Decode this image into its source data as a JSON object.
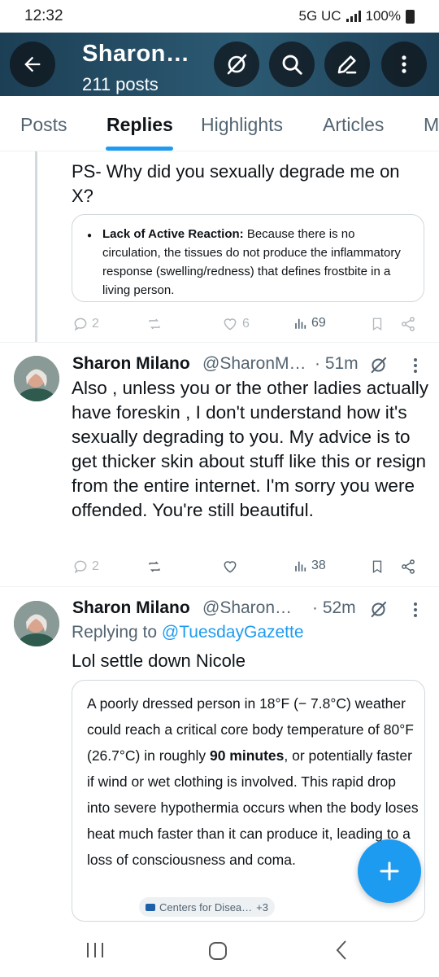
{
  "status_bar": {
    "time": "12:32",
    "network": "5G UC",
    "battery": "100%"
  },
  "header": {
    "title": "Sharon…",
    "subtitle": "211 posts"
  },
  "tabs": [
    {
      "label": "Posts"
    },
    {
      "label": "Replies",
      "active": true
    },
    {
      "label": "Highlights"
    },
    {
      "label": "Articles"
    },
    {
      "label": "M"
    }
  ],
  "posts": [
    {
      "text": "PS- Why did you sexually degrade me on X?",
      "card": {
        "bold": "Lack of Active Reaction:",
        "text": " Because there is no circulation, the tissues do not produce the inflammatory response (swelling/redness) that defines frostbite in a living person."
      },
      "actions": {
        "replies": "2",
        "likes": "6",
        "views": "69"
      }
    },
    {
      "author": "Sharon Milano",
      "handle": "@SharonM…",
      "time": "· 51m",
      "text": "Also , unless you or the other ladies actually have foreskin , I don't understand how it's sexually degrading to you. My advice is to get thicker skin about stuff like this or resign from the entire internet. I'm sorry you were offended. You're still beautiful.",
      "actions": {
        "replies": "2",
        "views": "38"
      }
    },
    {
      "author": "Sharon Milano",
      "handle": "@Sharon…",
      "time": "· 52m",
      "replying_to_label": "Replying to",
      "replying_to_handle": "@TuesdayGazette",
      "text": "Lol settle down Nicole",
      "card": {
        "text_before": "A poorly dressed person in 18°F (− 7.8°C) weather could reach a critical core body temperature of 80°F (26.7°C) in roughly ",
        "bold": "90 minutes",
        "text_after": ", or potentially faster if wind or wet clothing is involved. This rapid drop into severe hypothermia occurs when the body loses heat much faster than it can produce it, leading to a loss of consciousness and coma.",
        "source_chip": "Centers for Disea…",
        "source_count": "+3"
      }
    }
  ],
  "colors": {
    "accent": "#1d9bf0",
    "text": "#0f1419",
    "muted": "#536471",
    "header": "#2c5a73"
  }
}
